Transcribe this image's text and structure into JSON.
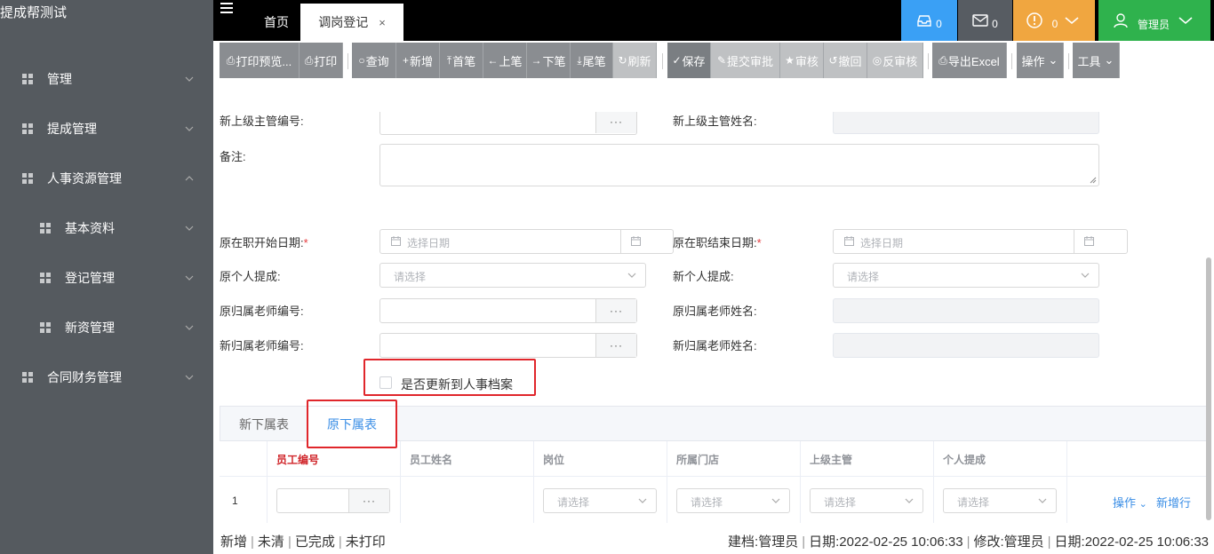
{
  "app": {
    "title": "提成帮测试"
  },
  "sidebar": {
    "items": [
      {
        "label": "管理",
        "level": 1,
        "expanded": false
      },
      {
        "label": "提成管理",
        "level": 1,
        "expanded": false
      },
      {
        "label": "人事资源管理",
        "level": 1,
        "expanded": true
      },
      {
        "label": "基本资料",
        "level": 2,
        "expanded": false
      },
      {
        "label": "登记管理",
        "level": 2,
        "expanded": false
      },
      {
        "label": "新资管理",
        "level": 2,
        "expanded": false
      },
      {
        "label": "合同财务管理",
        "level": 1,
        "expanded": false
      }
    ]
  },
  "tabs": {
    "home": "首页",
    "active": "调岗登记",
    "close": "×"
  },
  "header": {
    "inbox_count": "0",
    "mail_count": "0",
    "alert_count": "0",
    "user": "管理员"
  },
  "toolbar": {
    "print_preview": "打印预览...",
    "print": "打印",
    "query": "查询",
    "add": "新增",
    "first": "首笔",
    "prev": "上笔",
    "next": "下笔",
    "last": "尾笔",
    "refresh": "刷新",
    "save": "保存",
    "submit": "提交审批",
    "approve": "审核",
    "withdraw": "撤回",
    "unapprove": "反审核",
    "export": "导出Excel",
    "operation": "操作",
    "tools": "工具"
  },
  "form": {
    "new_supervisor_no": "新上级主管编号:",
    "new_supervisor_name": "新上级主管姓名:",
    "remark": "备注:",
    "orig_start": "原在职开始日期:",
    "orig_end": "原在职结束日期:",
    "date_placeholder": "选择日期",
    "orig_commission": "原个人提成:",
    "new_commission": "新个人提成:",
    "select_placeholder": "请选择",
    "orig_teacher_no": "原归属老师编号:",
    "orig_teacher_name": "原归属老师姓名:",
    "new_teacher_no": "新归属老师编号:",
    "new_teacher_name": "新归属老师姓名:",
    "update_archive": "是否更新到人事档案",
    "dots": "···",
    "required": "*"
  },
  "subtabs": {
    "new_sub": "新下属表",
    "orig_sub": "原下属表"
  },
  "grid": {
    "columns": [
      "员工编号",
      "员工姓名",
      "岗位",
      "所属门店",
      "上级主管",
      "个人提成"
    ],
    "row_index": "1",
    "row_placeholder": "请选择",
    "actions": "操作",
    "add_row": "新增行"
  },
  "footer": {
    "status": [
      "新增",
      "未清",
      "已完成",
      "未打印"
    ],
    "created_by": "建档:管理员",
    "created_date": "日期:2022-02-25 10:06:33",
    "modified_by": "修改:管理员",
    "modified_date": "日期:2022-02-25 10:06:33"
  },
  "colors": {
    "sidebar": "#555a5f",
    "topbar": "#000000",
    "inbox": "#3aa0f5",
    "alert": "#f0a640",
    "user": "#2fb24d",
    "required": "#e4393c",
    "highlight": "#e0262b",
    "active_tab": "#3a8ee6"
  }
}
